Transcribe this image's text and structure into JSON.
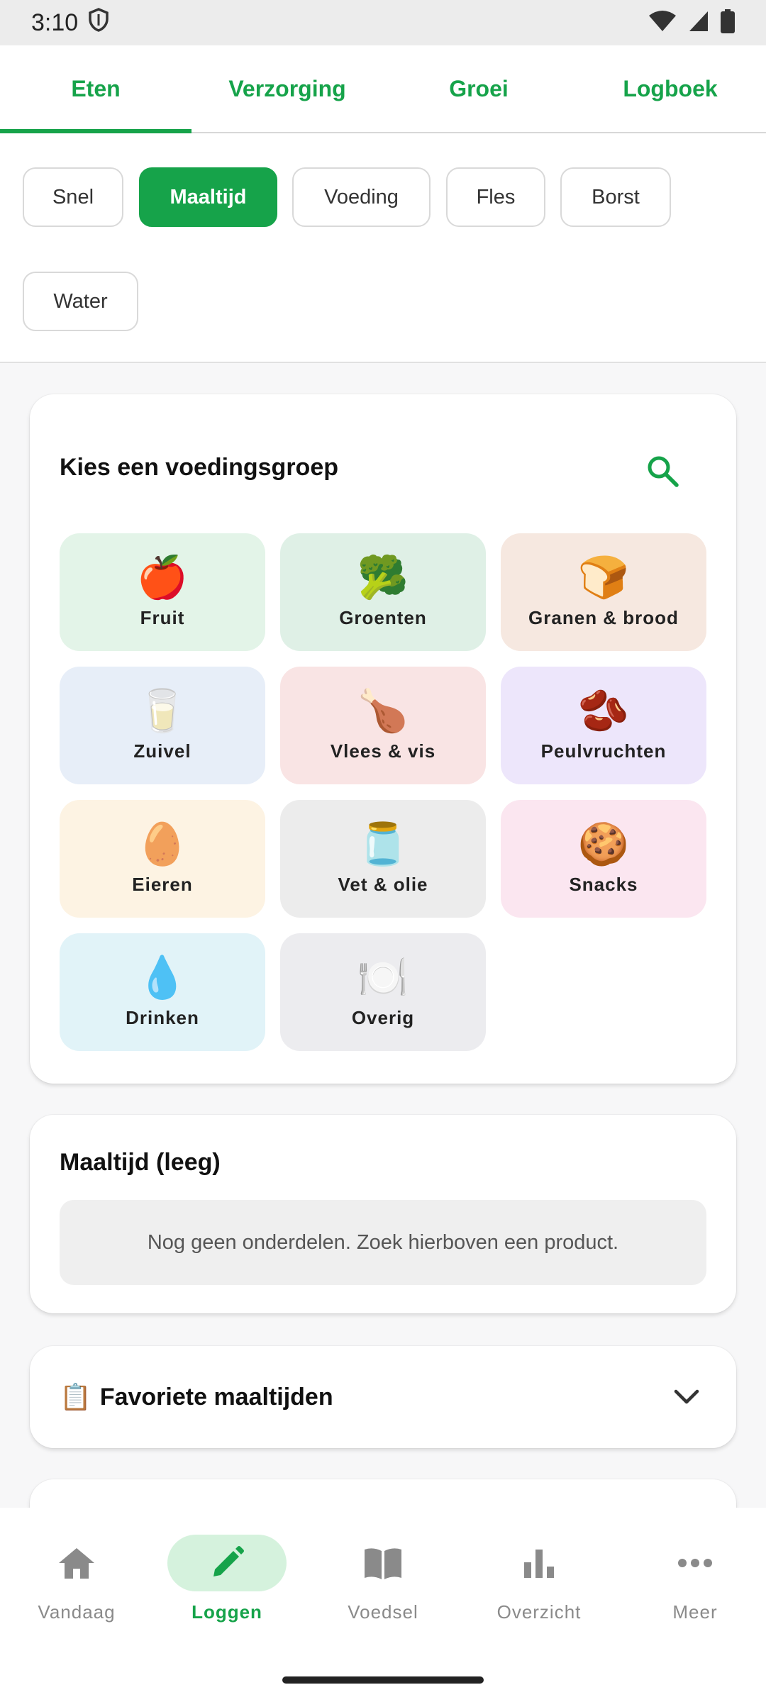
{
  "status": {
    "time": "3:10"
  },
  "top_tabs": [
    {
      "label": "Eten",
      "active": true
    },
    {
      "label": "Verzorging",
      "active": false
    },
    {
      "label": "Groei",
      "active": false
    },
    {
      "label": "Logboek",
      "active": false
    }
  ],
  "chips": [
    {
      "label": "Snel",
      "active": false
    },
    {
      "label": "Maaltijd",
      "active": true
    },
    {
      "label": "Voeding",
      "active": false
    },
    {
      "label": "Fles",
      "active": false
    },
    {
      "label": "Borst",
      "active": false
    },
    {
      "label": "Water",
      "active": false
    }
  ],
  "food_group_card": {
    "title": "Kies een voedingsgroep",
    "search_icon": "search-icon",
    "groups": [
      {
        "label": "Fruit",
        "emoji": "🍎",
        "color": "#e3f4e8"
      },
      {
        "label": "Groenten",
        "emoji": "🥦",
        "color": "#dff0e6"
      },
      {
        "label": "Granen & brood",
        "emoji": "🍞",
        "color": "#f6e8e0"
      },
      {
        "label": "Zuivel",
        "emoji": "🥛",
        "color": "#e7eef8"
      },
      {
        "label": "Vlees & vis",
        "emoji": "🍗",
        "color": "#f9e4e4"
      },
      {
        "label": "Peulvruchten",
        "emoji": "🫘",
        "color": "#ede6fb"
      },
      {
        "label": "Eieren",
        "emoji": "🥚",
        "color": "#fdf3e3"
      },
      {
        "label": "Vet & olie",
        "emoji": "🫙",
        "color": "#ececec"
      },
      {
        "label": "Snacks",
        "emoji": "🍪",
        "color": "#fbe6f0"
      },
      {
        "label": "Drinken",
        "emoji": "💧",
        "color": "#e1f3f8"
      },
      {
        "label": "Overig",
        "emoji": "🍽️",
        "color": "#ececef"
      }
    ]
  },
  "meal_card": {
    "title": "Maaltijd (leeg)",
    "empty_text": "Nog geen onderdelen. Zoek hierboven een product."
  },
  "favorites_card": {
    "icon": "📋",
    "title": "Favoriete maaltijden",
    "chevron": "chevron-down-icon"
  },
  "bottom_nav": [
    {
      "label": "Vandaag",
      "icon": "home-icon",
      "active": false
    },
    {
      "label": "Loggen",
      "icon": "pencil-icon",
      "active": true
    },
    {
      "label": "Voedsel",
      "icon": "book-icon",
      "active": false
    },
    {
      "label": "Overzicht",
      "icon": "bar-chart-icon",
      "active": false
    },
    {
      "label": "Meer",
      "icon": "more-dots-icon",
      "active": false
    }
  ],
  "colors": {
    "accent": "#16a34a",
    "nav_active_bg": "#d5f2dd"
  }
}
